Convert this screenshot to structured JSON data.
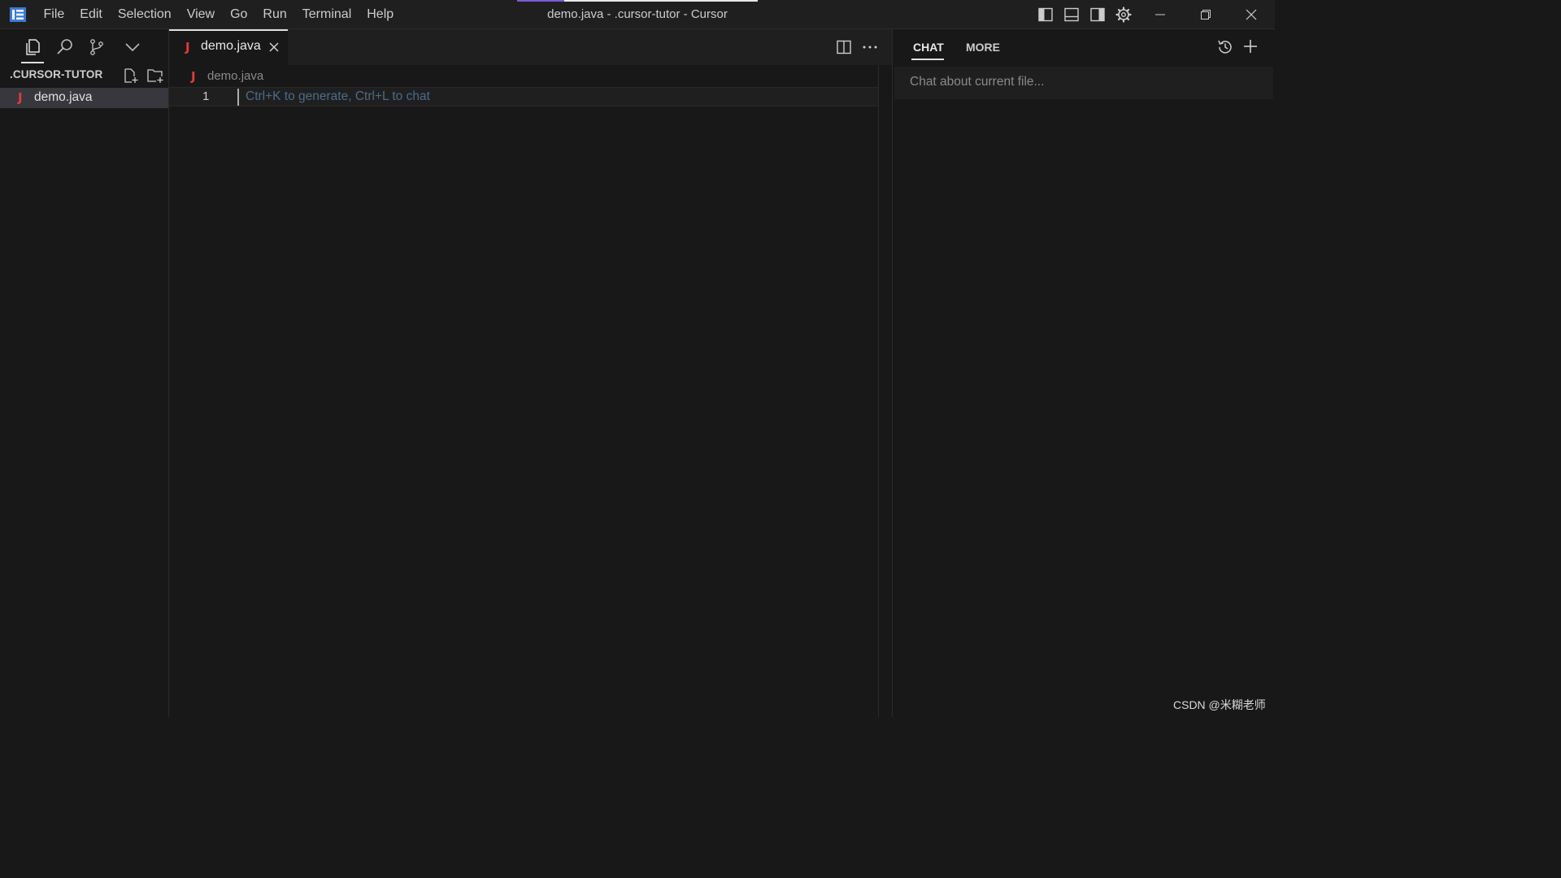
{
  "titlebar": {
    "menu": [
      "File",
      "Edit",
      "Selection",
      "View",
      "Go",
      "Run",
      "Terminal",
      "Help"
    ],
    "window_title": "demo.java - .cursor-tutor - Cursor",
    "controls": [
      "toggle-primary-sidebar-icon",
      "toggle-panel-icon",
      "toggle-secondary-sidebar-icon",
      "settings-gear-icon",
      "minimize-icon",
      "restore-icon",
      "close-icon"
    ]
  },
  "activity": {
    "icons": [
      "explorer-icon",
      "search-icon",
      "source-control-icon",
      "chevron-down-icon"
    ],
    "active": "explorer-icon"
  },
  "explorer": {
    "folder_title": ".CURSOR-TUTOR",
    "actions": [
      "new-file-icon",
      "new-folder-icon"
    ],
    "files": [
      {
        "name": "demo.java",
        "icon": "J",
        "selected": true
      }
    ]
  },
  "editor": {
    "tab_label": "demo.java",
    "tab_icon": "J",
    "breadcrumb": "demo.java",
    "line_number": "1",
    "placeholder": "Ctrl+K to generate, Ctrl+L to chat",
    "actions": [
      "split-editor-icon",
      "more-actions-icon"
    ]
  },
  "chat": {
    "tabs": [
      "CHAT",
      "MORE"
    ],
    "active_tab": "CHAT",
    "placeholder": "Chat about current file...",
    "actions": [
      "history-icon",
      "new-chat-icon"
    ]
  },
  "watermark": "CSDN @米糊老师",
  "colors": {
    "background": "#181818",
    "titlebar": "#1f1f1f",
    "java_icon": "#e03b3b",
    "accent": "#7c5bd6"
  }
}
